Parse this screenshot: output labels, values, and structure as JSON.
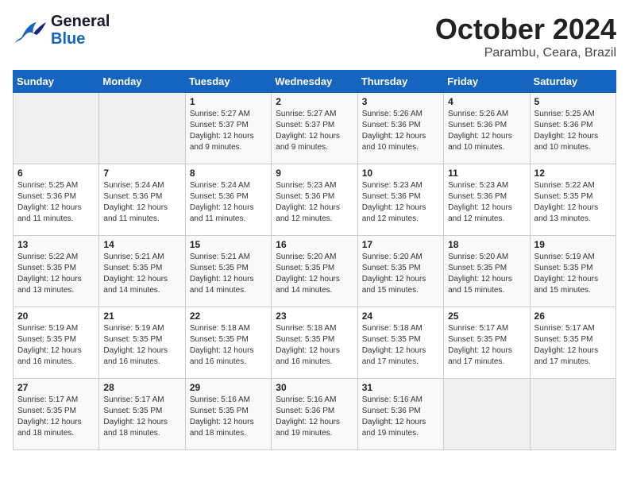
{
  "logo": {
    "line1": "General",
    "line2": "Blue"
  },
  "title": "October 2024",
  "subtitle": "Parambu, Ceara, Brazil",
  "headers": [
    "Sunday",
    "Monday",
    "Tuesday",
    "Wednesday",
    "Thursday",
    "Friday",
    "Saturday"
  ],
  "weeks": [
    [
      {
        "day": "",
        "info": ""
      },
      {
        "day": "",
        "info": ""
      },
      {
        "day": "1",
        "info": "Sunrise: 5:27 AM\nSunset: 5:37 PM\nDaylight: 12 hours\nand 9 minutes."
      },
      {
        "day": "2",
        "info": "Sunrise: 5:27 AM\nSunset: 5:37 PM\nDaylight: 12 hours\nand 9 minutes."
      },
      {
        "day": "3",
        "info": "Sunrise: 5:26 AM\nSunset: 5:36 PM\nDaylight: 12 hours\nand 10 minutes."
      },
      {
        "day": "4",
        "info": "Sunrise: 5:26 AM\nSunset: 5:36 PM\nDaylight: 12 hours\nand 10 minutes."
      },
      {
        "day": "5",
        "info": "Sunrise: 5:25 AM\nSunset: 5:36 PM\nDaylight: 12 hours\nand 10 minutes."
      }
    ],
    [
      {
        "day": "6",
        "info": "Sunrise: 5:25 AM\nSunset: 5:36 PM\nDaylight: 12 hours\nand 11 minutes."
      },
      {
        "day": "7",
        "info": "Sunrise: 5:24 AM\nSunset: 5:36 PM\nDaylight: 12 hours\nand 11 minutes."
      },
      {
        "day": "8",
        "info": "Sunrise: 5:24 AM\nSunset: 5:36 PM\nDaylight: 12 hours\nand 11 minutes."
      },
      {
        "day": "9",
        "info": "Sunrise: 5:23 AM\nSunset: 5:36 PM\nDaylight: 12 hours\nand 12 minutes."
      },
      {
        "day": "10",
        "info": "Sunrise: 5:23 AM\nSunset: 5:36 PM\nDaylight: 12 hours\nand 12 minutes."
      },
      {
        "day": "11",
        "info": "Sunrise: 5:23 AM\nSunset: 5:36 PM\nDaylight: 12 hours\nand 12 minutes."
      },
      {
        "day": "12",
        "info": "Sunrise: 5:22 AM\nSunset: 5:35 PM\nDaylight: 12 hours\nand 13 minutes."
      }
    ],
    [
      {
        "day": "13",
        "info": "Sunrise: 5:22 AM\nSunset: 5:35 PM\nDaylight: 12 hours\nand 13 minutes."
      },
      {
        "day": "14",
        "info": "Sunrise: 5:21 AM\nSunset: 5:35 PM\nDaylight: 12 hours\nand 14 minutes."
      },
      {
        "day": "15",
        "info": "Sunrise: 5:21 AM\nSunset: 5:35 PM\nDaylight: 12 hours\nand 14 minutes."
      },
      {
        "day": "16",
        "info": "Sunrise: 5:20 AM\nSunset: 5:35 PM\nDaylight: 12 hours\nand 14 minutes."
      },
      {
        "day": "17",
        "info": "Sunrise: 5:20 AM\nSunset: 5:35 PM\nDaylight: 12 hours\nand 15 minutes."
      },
      {
        "day": "18",
        "info": "Sunrise: 5:20 AM\nSunset: 5:35 PM\nDaylight: 12 hours\nand 15 minutes."
      },
      {
        "day": "19",
        "info": "Sunrise: 5:19 AM\nSunset: 5:35 PM\nDaylight: 12 hours\nand 15 minutes."
      }
    ],
    [
      {
        "day": "20",
        "info": "Sunrise: 5:19 AM\nSunset: 5:35 PM\nDaylight: 12 hours\nand 16 minutes."
      },
      {
        "day": "21",
        "info": "Sunrise: 5:19 AM\nSunset: 5:35 PM\nDaylight: 12 hours\nand 16 minutes."
      },
      {
        "day": "22",
        "info": "Sunrise: 5:18 AM\nSunset: 5:35 PM\nDaylight: 12 hours\nand 16 minutes."
      },
      {
        "day": "23",
        "info": "Sunrise: 5:18 AM\nSunset: 5:35 PM\nDaylight: 12 hours\nand 16 minutes."
      },
      {
        "day": "24",
        "info": "Sunrise: 5:18 AM\nSunset: 5:35 PM\nDaylight: 12 hours\nand 17 minutes."
      },
      {
        "day": "25",
        "info": "Sunrise: 5:17 AM\nSunset: 5:35 PM\nDaylight: 12 hours\nand 17 minutes."
      },
      {
        "day": "26",
        "info": "Sunrise: 5:17 AM\nSunset: 5:35 PM\nDaylight: 12 hours\nand 17 minutes."
      }
    ],
    [
      {
        "day": "27",
        "info": "Sunrise: 5:17 AM\nSunset: 5:35 PM\nDaylight: 12 hours\nand 18 minutes."
      },
      {
        "day": "28",
        "info": "Sunrise: 5:17 AM\nSunset: 5:35 PM\nDaylight: 12 hours\nand 18 minutes."
      },
      {
        "day": "29",
        "info": "Sunrise: 5:16 AM\nSunset: 5:35 PM\nDaylight: 12 hours\nand 18 minutes."
      },
      {
        "day": "30",
        "info": "Sunrise: 5:16 AM\nSunset: 5:36 PM\nDaylight: 12 hours\nand 19 minutes."
      },
      {
        "day": "31",
        "info": "Sunrise: 5:16 AM\nSunset: 5:36 PM\nDaylight: 12 hours\nand 19 minutes."
      },
      {
        "day": "",
        "info": ""
      },
      {
        "day": "",
        "info": ""
      }
    ]
  ]
}
